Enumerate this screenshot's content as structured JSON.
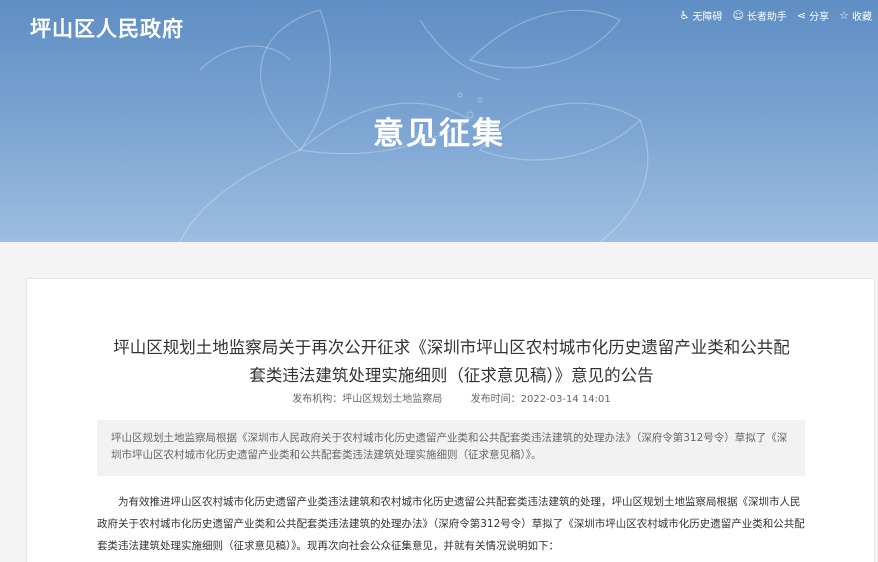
{
  "header": {
    "site_title": "坪山区人民政府",
    "banner_title": "意见征集",
    "tools": [
      {
        "icon": "accessibility-icon",
        "glyph": "♿",
        "label": "无障碍"
      },
      {
        "icon": "elder-icon",
        "glyph": "☺",
        "label": "长者助手"
      },
      {
        "icon": "share-icon",
        "glyph": "⋖",
        "label": "分享"
      },
      {
        "icon": "star-icon",
        "glyph": "☆",
        "label": "收藏"
      }
    ]
  },
  "article": {
    "title_line1": "坪山区规划土地监察局关于再次公开征求《深圳市坪山区农村城市化历史遗留产业类和公共配",
    "title_line2": "套类违法建筑处理实施细则（征求意见稿）》意见的公告",
    "publisher": "发布机构：坪山区规划土地监察局",
    "publish_time": "发布时间：2022-03-14 14:01",
    "summary": "坪山区规划土地监察局根据《深圳市人民政府关于农村城市化历史遗留产业类和公共配套类违法建筑的处理办法》（深府令第312号令）草拟了《深圳市坪山区农村城市化历史遗留产业类和公共配套类违法建筑处理实施细则（征求意见稿）》。",
    "body": "为有效推进坪山区农村城市化历史遗留产业类违法建筑和农村城市化历史遗留公共配套类违法建筑的处理，坪山区规划土地监察局根据《深圳市人民政府关于农村城市化历史遗留产业类和公共配套类违法建筑的处理办法》（深府令第312号令）草拟了《深圳市坪山区农村城市化历史遗留产业类和公共配套类违法建筑处理实施细则（征求意见稿）》。现再次向社会公众征集意见，并就有关情况说明如下："
  },
  "colors": {
    "banner_top": "#5f8ec4",
    "banner_bottom": "#9dbde1",
    "card_bg": "#ffffff",
    "summary_bg": "#f2f2f2"
  }
}
